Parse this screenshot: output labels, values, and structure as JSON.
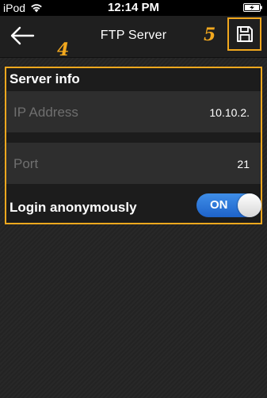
{
  "status_bar": {
    "carrier": "iPod",
    "time": "12:14 PM",
    "wifi_icon": "wifi-icon",
    "battery_icon": "battery-charging-icon"
  },
  "nav": {
    "title": "FTP Server",
    "back_icon": "back-arrow-icon",
    "save_icon": "save-icon",
    "marker_save": "5"
  },
  "server_info": {
    "marker": "4",
    "title": "Server info",
    "ip_label": "IP Address",
    "ip_value": "10.10.2.",
    "port_label": "Port",
    "port_value": "21",
    "login_label": "Login anonymously",
    "login_toggle": "ON"
  },
  "colors": {
    "accent": "#f2a81e",
    "toggle_on": "#2a74d8"
  }
}
